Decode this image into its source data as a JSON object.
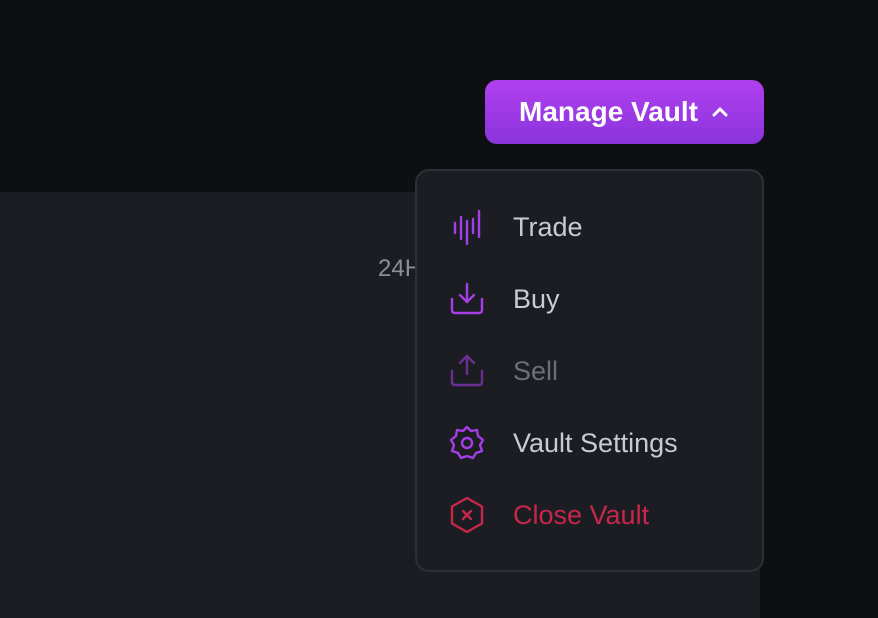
{
  "panel": {
    "partial_label": "24H"
  },
  "header": {
    "manage_button_label": "Manage Vault",
    "chevron_icon": "chevron-up-icon"
  },
  "menu": {
    "items": [
      {
        "label": "Trade",
        "icon": "trade-bars-icon",
        "state": "enabled"
      },
      {
        "label": "Buy",
        "icon": "download-tray-icon",
        "state": "enabled"
      },
      {
        "label": "Sell",
        "icon": "upload-tray-icon",
        "state": "disabled"
      },
      {
        "label": "Vault Settings",
        "icon": "gear-icon",
        "state": "enabled"
      },
      {
        "label": "Close Vault",
        "icon": "hexagon-x-icon",
        "state": "danger"
      }
    ]
  },
  "colors": {
    "background": "#0e0f13",
    "panel": "#1b1d22",
    "accent_start": "#b13ff0",
    "accent_end": "#8a34dc",
    "icon_purple": "#a63ee8",
    "danger": "#c8264b",
    "text": "#c9cbd0",
    "text_disabled": "#6c6f76"
  }
}
